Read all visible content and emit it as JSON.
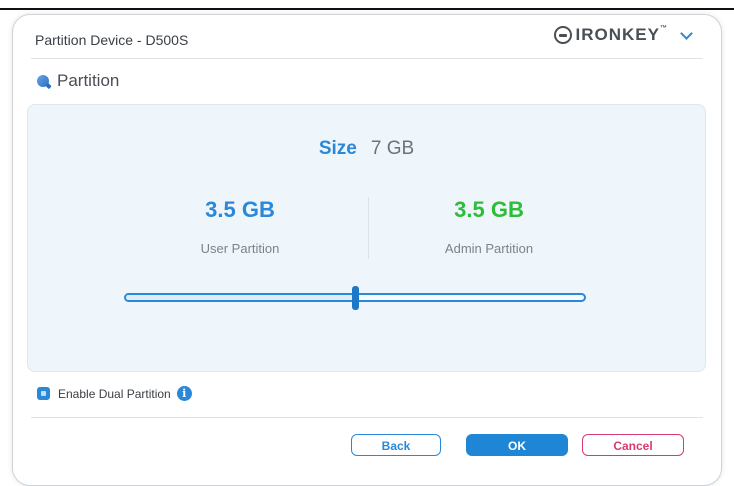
{
  "window": {
    "title": "Partition Device - D500S",
    "brand": "IRONKEY",
    "brand_tm": "™"
  },
  "section": {
    "title": "Partition"
  },
  "partition": {
    "size_label": "Size",
    "size_value": "7 GB",
    "user_amount": "3.5 GB",
    "user_label": "User Partition",
    "admin_amount": "3.5 GB",
    "admin_label": "Admin Partition",
    "slider_fraction": 0.5
  },
  "options": {
    "dual_partition_label": "Enable Dual Partition",
    "dual_partition_checked": true,
    "info_glyph": "i"
  },
  "buttons": {
    "back": "Back",
    "ok": "OK",
    "cancel": "Cancel"
  },
  "colors": {
    "accent": "#2b88d8",
    "user": "#2b88d8",
    "admin": "#2ebd3a",
    "cancel": "#d73b6e"
  },
  "icons": {
    "brand": "ironkey-logo-icon",
    "dropdown": "chevron-down-icon",
    "section": "partition-icon",
    "info": "info-icon"
  }
}
